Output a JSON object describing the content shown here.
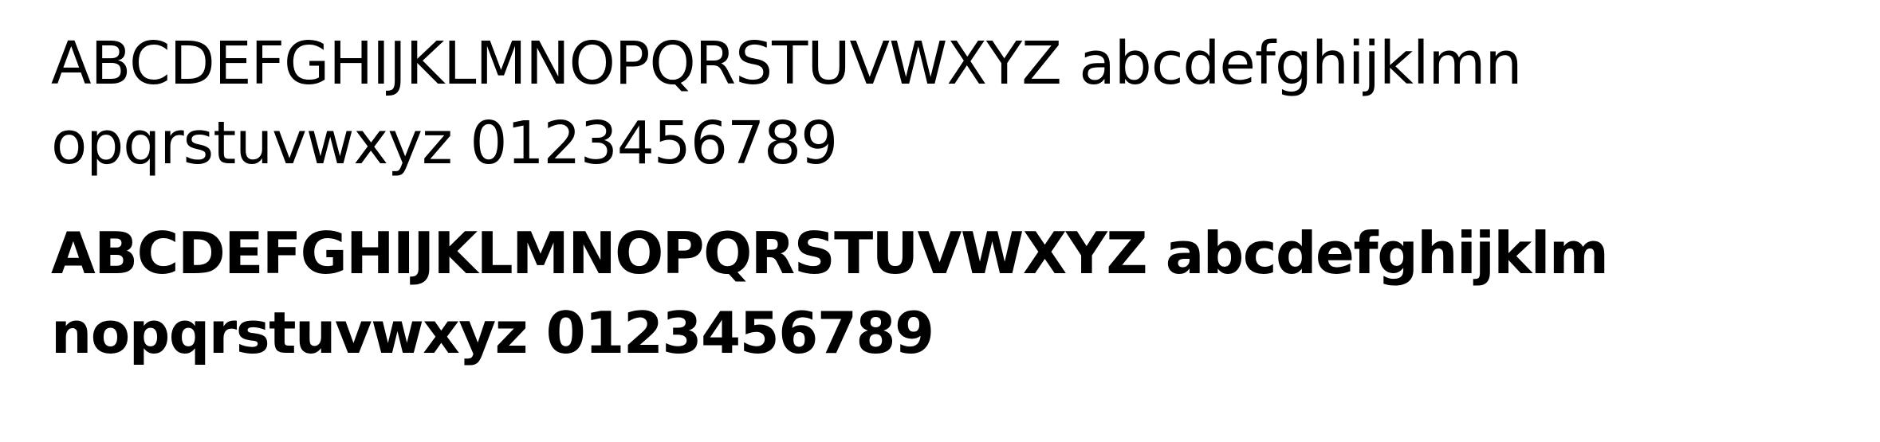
{
  "specimen": {
    "regular": {
      "line1": "ABCDEFGHIJKLMNOPQRSTUVWXYZ abcdefghijklmn",
      "line2": "opqrstuvwxyz 0123456789"
    },
    "bold": {
      "line1": "ABCDEFGHIJKLMNOPQRSTUVWXYZ abcdefghijklm",
      "line2": "nopqrstuvwxyz 0123456789"
    }
  }
}
